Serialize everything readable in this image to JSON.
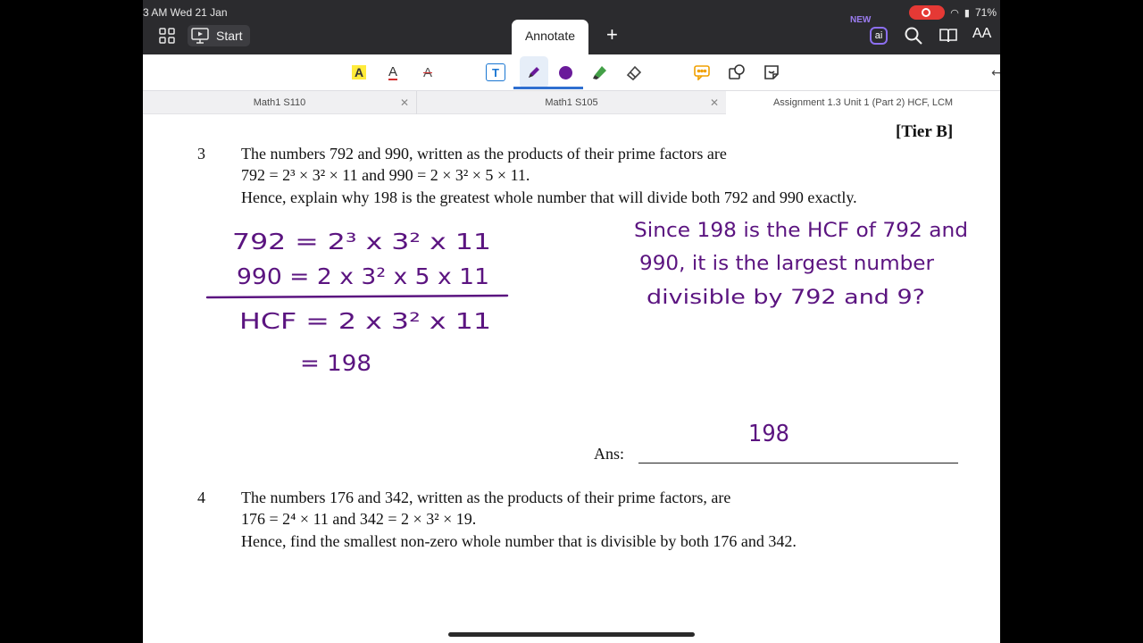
{
  "status": {
    "time": "3 AM  Wed 21 Jan",
    "battery": "71%"
  },
  "topbar": {
    "start_label": "Start",
    "annotate_label": "Annotate",
    "new_badge": "NEW",
    "ai_label": "ai",
    "font_label": "AA"
  },
  "toolbar": {
    "highlight_label": "A",
    "underline_label": "A",
    "strike_label": "A",
    "text_label": "T",
    "pen_color": "#6a1b9a"
  },
  "doc_tabs": [
    {
      "label": "Math1 S110",
      "active": false
    },
    {
      "label": "Math1 S105",
      "active": false
    },
    {
      "label": "Assignment 1.3 Unit 1 (Part 2) HCF, LCM",
      "active": true
    }
  ],
  "page": {
    "tier": "[Tier B]",
    "q3": {
      "number": "3",
      "line1": "The numbers 792 and 990, written as the products of their prime factors are",
      "line2": "792 = 2³ × 3² × 11  and 990 = 2 × 3² × 5 × 11.",
      "line3": "Hence, explain why 198 is the greatest whole number that will divide both 792 and 990 exactly.",
      "ans_label": "Ans:"
    },
    "q4": {
      "number": "4",
      "line1": "The numbers 176 and 342, written as the products of their prime factors, are",
      "line2": "176 = 2⁴ × 11 and 342 = 2 × 3² × 19.",
      "line3": "Hence, find the smallest non-zero whole number that is divisible by both 176 and 342."
    },
    "handwriting": {
      "work_line1": "792 = 2³ x 3²     x 11",
      "work_line2": "990 = 2 x 3² x 5 x 11",
      "work_line3": "HCF = 2 x 3²      x 11",
      "work_line4": "= 198",
      "note_line1": "Since 198 is the HCF of 792 and",
      "note_line2": "990, it is the largest number",
      "note_line3": "divisible by 792 and 9?",
      "answer": "198"
    }
  }
}
